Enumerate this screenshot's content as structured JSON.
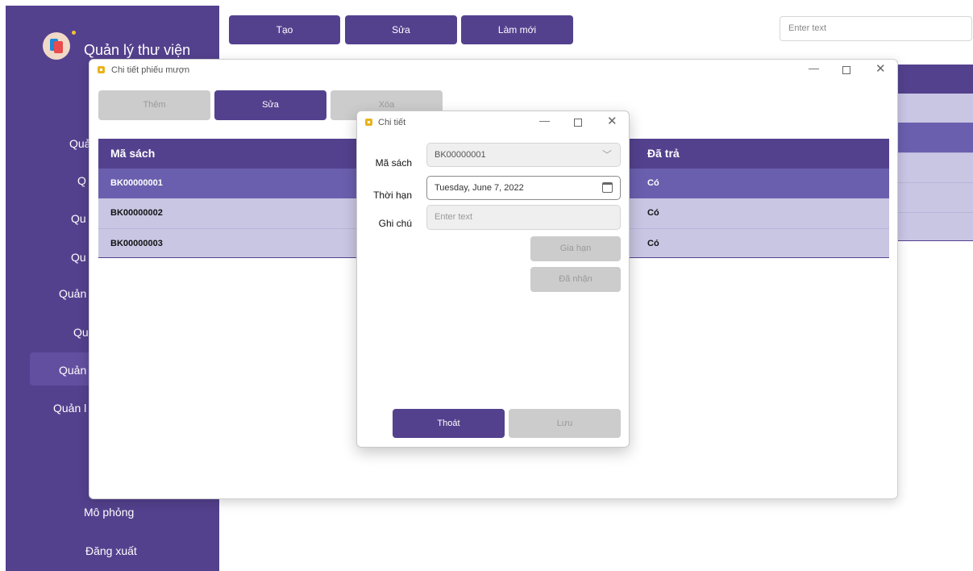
{
  "app": {
    "title": "Quản lý thư viện"
  },
  "sidebar": {
    "items": [
      {
        "label": "Quả"
      },
      {
        "label": "Q"
      },
      {
        "label": "Qu"
      },
      {
        "label": "Qu"
      },
      {
        "label": "Quản"
      },
      {
        "label": "Qu"
      },
      {
        "label": "Quản"
      },
      {
        "label": "Quản l"
      },
      {
        "label": "Mô phỏng"
      },
      {
        "label": "Đăng xuất"
      }
    ]
  },
  "toolbar": {
    "create_label": "Tạo",
    "edit_label": "Sửa",
    "refresh_label": "Làm mới",
    "search_placeholder": "Enter text"
  },
  "borrow_window": {
    "title": "Chi tiết phiếu mượn",
    "add_label": "Thêm",
    "edit_label": "Sửa",
    "delete_label": "Xóa",
    "columns": [
      "Mã sách",
      "Đã trả"
    ],
    "rows": [
      {
        "book_id": "BK00000001",
        "returned": "Có"
      },
      {
        "book_id": "BK00000002",
        "returned": "Có"
      },
      {
        "book_id": "BK00000003",
        "returned": "Có"
      }
    ]
  },
  "detail_dialog": {
    "title": "Chi tiết",
    "book_label": "Mã sách",
    "book_value": "BK00000001",
    "due_label": "Thời hạn",
    "due_value": "Tuesday, June 7, 2022",
    "note_label": "Ghi chú",
    "note_placeholder": "Enter text",
    "extend_label": "Gia hạn",
    "received_label": "Đã nhận",
    "exit_label": "Thoát",
    "save_label": "Lưu"
  },
  "colors": {
    "primary": "#54418e",
    "row_selected": "#6a5fae",
    "row_normal": "#c9c6e4",
    "disabled": "#cccccc"
  }
}
